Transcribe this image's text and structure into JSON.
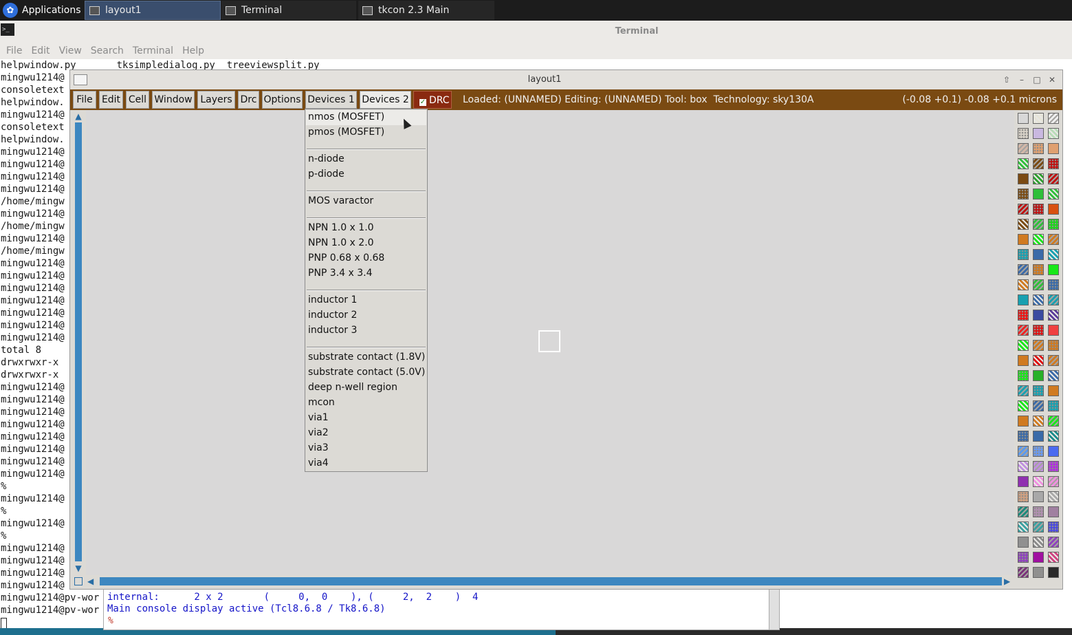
{
  "taskbar": {
    "applications_label": "Applications",
    "tasks": [
      {
        "label": "layout1"
      },
      {
        "label": "Terminal"
      },
      {
        "label": "tkcon 2.3 Main"
      }
    ]
  },
  "terminal": {
    "title": "Terminal",
    "menu": [
      "File",
      "Edit",
      "View",
      "Search",
      "Terminal",
      "Help"
    ],
    "lines": [
      "helpwindow.py       tksimpledialog.py  treeviewsplit.py",
      "mingwu1214@",
      "consoletext",
      "helpwindow.",
      "mingwu1214@",
      "consoletext",
      "helpwindow.",
      "mingwu1214@",
      "mingwu1214@",
      "mingwu1214@",
      "mingwu1214@",
      "/home/mingw",
      "mingwu1214@",
      "/home/mingw",
      "mingwu1214@",
      "/home/mingw",
      "mingwu1214@",
      "mingwu1214@",
      "mingwu1214@",
      "mingwu1214@",
      "mingwu1214@",
      "mingwu1214@",
      "mingwu1214@",
      "total 8",
      "drwxrwxr-x",
      "drwxrwxr-x",
      "mingwu1214@",
      "mingwu1214@",
      "mingwu1214@",
      "mingwu1214@",
      "mingwu1214@",
      "mingwu1214@",
      "mingwu1214@",
      "mingwu1214@",
      "%",
      "mingwu1214@",
      "%",
      "mingwu1214@",
      "%",
      "mingwu1214@",
      "mingwu1214@",
      "mingwu1214@",
      "mingwu1214@",
      "mingwu1214@pv-wor",
      "mingwu1214@pv-wor"
    ]
  },
  "tkcon": {
    "line1": "internal:      2 x 2       (     0,  0    ), (     2,  2    )  4",
    "line2": "Main console display active (Tcl8.6.8 / Tk8.6.8)",
    "prompt": "%"
  },
  "layout": {
    "title": "layout1",
    "menus": [
      "File",
      "Edit",
      "Cell",
      "Window",
      "Layers",
      "Drc",
      "Options",
      "Devices 1",
      "Devices 2"
    ],
    "drc_label": "DRC",
    "drc_checked": true,
    "status": "Loaded: (UNNAMED) Editing: (UNNAMED) Tool: box  Technology: sky130A",
    "coords": "(-0.08 +0.1) -0.08 +0.1 microns",
    "menubar_color": "#7a4a12"
  },
  "devices_menu": {
    "items": [
      "nmos (MOSFET)",
      "pmos (MOSFET)",
      "---",
      "n-diode",
      "p-diode",
      "---",
      "MOS varactor",
      "---",
      "NPN 1.0 x 1.0",
      "NPN 1.0 x 2.0",
      "PNP 0.68 x 0.68",
      "PNP 3.4 x 3.4",
      "---",
      "inductor 1",
      "inductor 2",
      "inductor 3",
      "---",
      "substrate contact (1.8V)",
      "substrate contact (5.0V)",
      "deep n-well region",
      "mcon",
      "via1",
      "via2",
      "via3",
      "via4"
    ],
    "highlighted": "nmos (MOSFET)"
  },
  "palette": {
    "colors": [
      "#d8d8d8",
      "#e6e4d8",
      "#f0f0f0",
      "#d8d2c8",
      "#c9b8e0",
      "#b8dcb8",
      "#d4b8a8",
      "#e0a070",
      "#e0a070",
      "#2fbf3a",
      "#7a4a12",
      "#c01010",
      "#7a4a12",
      "#2fa02f",
      "#c01010",
      "#7a4a12",
      "#2fbf3a",
      "#2fbf3a",
      "#c01010",
      "#c01010",
      "#d85010",
      "#7a4a12",
      "#2fbf3a",
      "#18d818",
      "#d07a20",
      "#18e818",
      "#d07a20",
      "#18a0b0",
      "#3a6aa8",
      "#18a0b0",
      "#3a6aa8",
      "#d07a20",
      "#18e818",
      "#d07a20",
      "#2fbf3a",
      "#3a6aa8",
      "#18a0b0",
      "#3a6aa8",
      "#18a0b0",
      "#f01010",
      "#3a4aa0",
      "#5a3a9a",
      "#f02020",
      "#e01010",
      "#f04040",
      "#18e818",
      "#d07a20",
      "#d07a20",
      "#d07a20",
      "#e01010",
      "#d07a20",
      "#18e818",
      "#28b028",
      "#3a6aa8",
      "#18a0b0",
      "#18a0b0",
      "#d07a20",
      "#18e818",
      "#3a6aa8",
      "#18a0b0",
      "#d07a20",
      "#d07a20",
      "#18e818",
      "#3a6aa8",
      "#3a6aa8",
      "#1a8a8a",
      "#5a9af0",
      "#6a9af0",
      "#4a6af0",
      "#c090e0",
      "#c090e0",
      "#b030e0",
      "#9030b0",
      "#f090e0",
      "#f090e0",
      "#d0a080",
      "#a8a8a8",
      "#a8a8a8",
      "#1a8a7a",
      "#b090b0",
      "#a080a0",
      "#3aa0a0",
      "#3aa0a0",
      "#4a4ae0",
      "#909090",
      "#8a8a8a",
      "#9040c0",
      "#9040c0",
      "#a010a0",
      "#d04080",
      "#7a307a",
      "#909090",
      "#2a2a2a"
    ]
  }
}
